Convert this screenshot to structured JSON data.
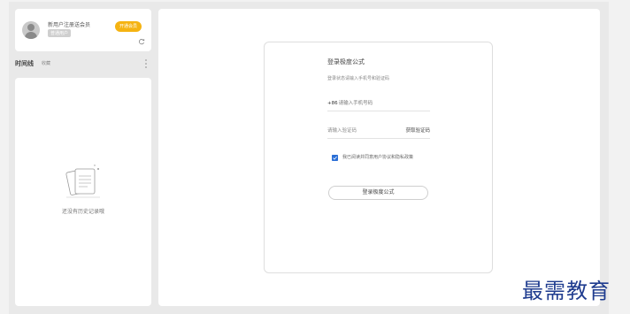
{
  "user": {
    "name": "新用户注册送会员",
    "tag": "普通用户",
    "vip_button": "开通会员"
  },
  "timeline": {
    "title": "时间线",
    "subtitle": "收藏"
  },
  "empty_state": {
    "text": "还没有历史记录哦"
  },
  "login": {
    "title": "登录极度公式",
    "subtitle": "登录状态请输入手机号和验证码",
    "phone_prefix": "+86",
    "phone_placeholder": "请输入手机号码",
    "code_placeholder": "请输入验证码",
    "get_code": "获取验证码",
    "agreement": "我已阅读并同意用户协议和隐私政策",
    "agreement_checked": true,
    "button": "登录极度公式"
  },
  "watermark": "最需教育",
  "colors": {
    "vip": "#f5b312",
    "checkbox": "#2b6fd6",
    "watermark": "#1f3c8f"
  }
}
